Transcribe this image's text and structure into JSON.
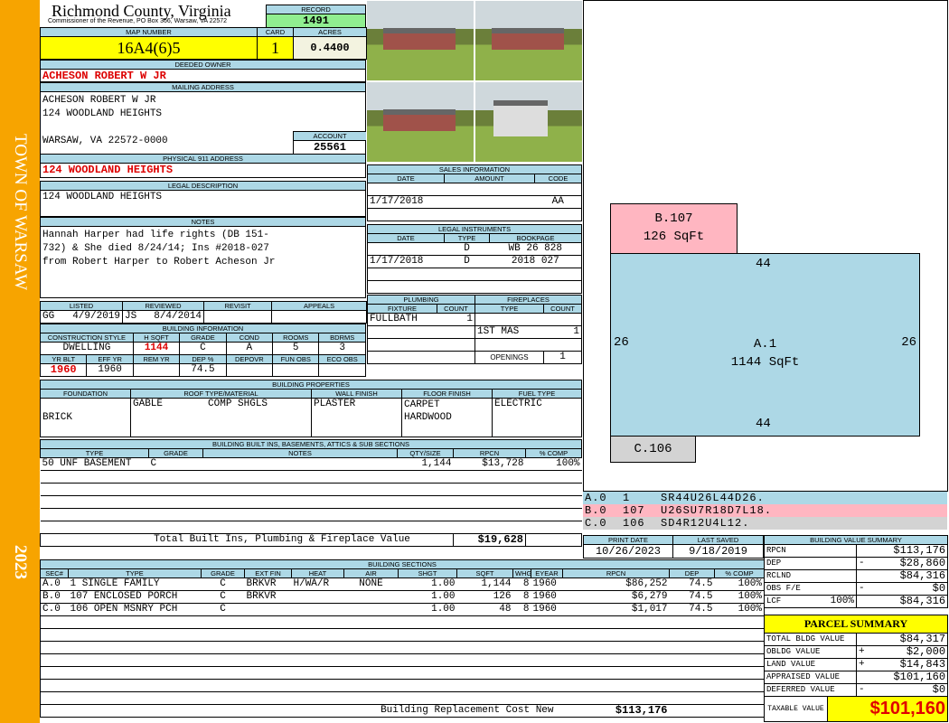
{
  "sidebar": {
    "town": "TOWN OF WARSAW",
    "year": "2023"
  },
  "header": {
    "title": "Richmond County, Virginia",
    "subtitle": "Commissioner of the Revenue, PO Box 366, Warsaw, VA 22572",
    "record_label": "RECORD",
    "record": "1491"
  },
  "parcel": {
    "map_label": "MAP NUMBER",
    "map": "16A4(6)5",
    "card_label": "CARD",
    "card": "1",
    "acres_label": "ACRES",
    "acres": "0.4400"
  },
  "owner": {
    "label": "DEEDED OWNER",
    "name": "ACHESON ROBERT W JR"
  },
  "mailing": {
    "label": "MAILING ADDRESS",
    "line1": "ACHESON ROBERT W JR",
    "line2": "124 WOODLAND HEIGHTS",
    "line3": "WARSAW, VA 22572-0000",
    "account_label": "ACCOUNT",
    "account": "25561"
  },
  "physical": {
    "label": "PHYSICAL 911 ADDRESS",
    "value": "124 WOODLAND HEIGHTS"
  },
  "legal": {
    "label": "LEGAL DESCRIPTION",
    "value": "124 WOODLAND HEIGHTS"
  },
  "notes": {
    "label": "NOTES",
    "lines": [
      "Hannah Harper had life rights (DB 151-",
      "732) & She died 8/24/14; Ins #2018-027",
      "from Robert Harper to Robert Acheson Jr"
    ]
  },
  "review": {
    "headers": [
      "LISTED",
      "REVIEWED",
      "REVISIT",
      "APPEALS"
    ],
    "listed_by": "GG",
    "listed": "4/9/2019",
    "reviewed_by": "JS",
    "reviewed": "8/4/2014",
    "revisit": "",
    "appeals": ""
  },
  "building_info": {
    "label": "BUILDING INFORMATION",
    "headers1": [
      "CONSTRUCTION STYLE",
      "H SQFT",
      "GRADE",
      "COND",
      "ROOMS",
      "BDRMS"
    ],
    "values1": [
      "DWELLING",
      "1144",
      "C",
      "A",
      "5",
      "3"
    ],
    "headers2": [
      "YR BLT",
      "EFF YR",
      "REM YR",
      "DEP %",
      "DEPOVR",
      "FUN OBS",
      "ECO OBS"
    ],
    "values2": [
      "1960",
      "1960",
      "",
      "74.5",
      "",
      "",
      ""
    ]
  },
  "sales": {
    "label": "SALES INFORMATION",
    "headers": [
      "DATE",
      "AMOUNT",
      "CODE"
    ],
    "rows": [
      [
        "",
        "",
        ""
      ],
      [
        "1/17/2018",
        "",
        "AA"
      ],
      [
        "",
        "",
        ""
      ]
    ]
  },
  "instruments": {
    "label": "LEGAL INSTRUMENTS",
    "headers": [
      "DATE",
      "TYPE",
      "BOOKPAGE"
    ],
    "rows": [
      [
        "",
        "D",
        "WB 26 828"
      ],
      [
        "1/17/2018",
        "D",
        "2018 027"
      ],
      [
        "",
        "",
        ""
      ],
      [
        "",
        "",
        ""
      ]
    ]
  },
  "plumbing": {
    "label": "PLUMBING",
    "headers": [
      "FIXTURE",
      "COUNT"
    ],
    "rows": [
      [
        "FULLBATH",
        "1"
      ],
      [
        "",
        ""
      ],
      [
        "",
        ""
      ],
      [
        "",
        ""
      ]
    ]
  },
  "fireplaces": {
    "label": "FIREPLACES",
    "headers": [
      "TYPE",
      "COUNT"
    ],
    "rows": [
      [
        "",
        ""
      ],
      [
        "1ST MAS",
        "1"
      ],
      [
        "",
        ""
      ]
    ],
    "openings_label": "OPENINGS",
    "openings": "1"
  },
  "properties": {
    "label": "BUILDING PROPERTIES",
    "headers": [
      "FOUNDATION",
      "ROOF TYPE/MATERIAL",
      "WALL FINISH",
      "FLOOR FINISH",
      "FUEL TYPE"
    ],
    "foundation": "BRICK",
    "roof_type": "GABLE",
    "roof_material": "COMP SHGLS",
    "wall": "PLASTER",
    "floor1": "CARPET",
    "floor2": "HARDWOOD",
    "fuel": "ELECTRIC"
  },
  "builtins": {
    "label": "BUILDING BUILT INS, BASEMENTS, ATTICS & SUB SECTIONS",
    "headers": [
      "TYPE",
      "GRADE",
      "NOTES",
      "QTY/SIZE",
      "RPCN",
      "% COMP"
    ],
    "rows": [
      [
        "50 UNF BASEMENT",
        "C",
        "",
        "1,144",
        "$13,728",
        "100%"
      ],
      [
        "",
        "",
        "",
        "",
        "",
        ""
      ],
      [
        "",
        "",
        "",
        "",
        "",
        ""
      ],
      [
        "",
        "",
        "",
        "",
        "",
        ""
      ],
      [
        "",
        "",
        "",
        "",
        "",
        ""
      ],
      [
        "",
        "",
        "",
        "",
        "",
        ""
      ]
    ],
    "total_label": "Total Built Ins, Plumbing & Fireplace Value",
    "total": "$19,628"
  },
  "dates": {
    "print_label": "PRINT DATE",
    "print": "10/26/2023",
    "saved_label": "LAST SAVED",
    "saved": "9/18/2019"
  },
  "sections": {
    "label": "BUILDING SECTIONS",
    "headers": [
      "SEC#",
      "TYPE",
      "GRADE",
      "EXT FIN",
      "HEAT",
      "AIR",
      "SHGT",
      "SQFT",
      "WHGT",
      "EYEAR",
      "RPCN",
      "DEP",
      "% COMP"
    ],
    "rows": [
      [
        "A.0",
        "1 SINGLE FAMILY",
        "C",
        "BRKVR",
        "H/WA/R",
        "NONE",
        "1.00",
        "1,144",
        "8",
        "1960",
        "$86,252",
        "74.5",
        "100%"
      ],
      [
        "B.0",
        "107 ENCLOSED PORCH",
        "C",
        "BRKVR",
        "",
        "",
        "1.00",
        "126",
        "8",
        "1960",
        "$6,279",
        "74.5",
        "100%"
      ],
      [
        "C.0",
        "106 OPEN MSNRY PCH",
        "C",
        "",
        "",
        "",
        "1.00",
        "48",
        "8",
        "1960",
        "$1,017",
        "74.5",
        "100%"
      ],
      [
        "",
        "",
        "",
        "",
        "",
        "",
        "",
        "",
        "",
        "",
        "",
        "",
        ""
      ],
      [
        "",
        "",
        "",
        "",
        "",
        "",
        "",
        "",
        "",
        "",
        "",
        "",
        ""
      ],
      [
        "",
        "",
        "",
        "",
        "",
        "",
        "",
        "",
        "",
        "",
        "",
        "",
        ""
      ],
      [
        "",
        "",
        "",
        "",
        "",
        "",
        "",
        "",
        "",
        "",
        "",
        "",
        ""
      ],
      [
        "",
        "",
        "",
        "",
        "",
        "",
        "",
        "",
        "",
        "",
        "",
        "",
        ""
      ],
      [
        "",
        "",
        "",
        "",
        "",
        "",
        "",
        "",
        "",
        "",
        "",
        "",
        ""
      ],
      [
        "",
        "",
        "",
        "",
        "",
        "",
        "",
        "",
        "",
        "",
        "",
        "",
        ""
      ]
    ],
    "replacement_label": "Building Replacement Cost New",
    "replacement": "$113,176"
  },
  "sketch": {
    "areas": [
      {
        "label": "B.107",
        "sqft": "126 SqFt"
      },
      {
        "label": "A.1",
        "sqft": "1144 SqFt"
      },
      {
        "label": "C.106"
      }
    ],
    "dims": {
      "top": "44",
      "bottom": "44",
      "left": "26",
      "right": "26"
    },
    "legend": [
      {
        "sec": "A.0",
        "code": "1",
        "path": "SR44U26L44D26.",
        "color": "#add8e6"
      },
      {
        "sec": "B.0",
        "code": "107",
        "path": "U26SU7R18D7L18.",
        "color": "#ffb6c1"
      },
      {
        "sec": "C.0",
        "code": "106",
        "path": "SD4R12U4L12.",
        "color": "#d3d3d3"
      }
    ]
  },
  "value_summary": {
    "label": "BUILDING VALUE SUMMARY",
    "rows": [
      {
        "label": "RPCN",
        "op": "",
        "value": "$113,176"
      },
      {
        "label": "DEP",
        "op": "-",
        "value": "$28,860"
      },
      {
        "label": "RCLND",
        "op": "",
        "value": "$84,316"
      },
      {
        "label": "OBS F/E",
        "op": "-",
        "value": "$0"
      },
      {
        "label": "LCF",
        "pct": "100%",
        "op": "",
        "value": "$84,316"
      }
    ]
  },
  "parcel_summary": {
    "label": "PARCEL SUMMARY",
    "rows": [
      {
        "label": "TOTAL BLDG VALUE",
        "op": "",
        "value": "$84,317"
      },
      {
        "label": "OBLDG VALUE",
        "op": "+",
        "value": "$2,000"
      },
      {
        "label": "LAND VALUE",
        "op": "+",
        "value": "$14,843"
      },
      {
        "label": "APPRAISED VALUE",
        "op": "",
        "value": "$101,160"
      },
      {
        "label": "DEFERRED VALUE",
        "op": "-",
        "value": "$0"
      }
    ],
    "taxable_label": "TAXABLE VALUE",
    "taxable": "$101,160"
  }
}
